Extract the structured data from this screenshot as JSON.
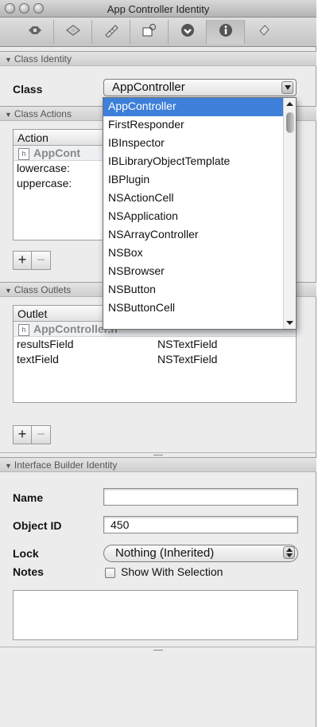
{
  "window": {
    "title": "App Controller Identity"
  },
  "toolbar": {
    "tabs": [
      {
        "icon": "attributes-icon"
      },
      {
        "icon": "effects-icon"
      },
      {
        "icon": "size-icon"
      },
      {
        "icon": "connections-icon"
      },
      {
        "icon": "bindings-icon"
      },
      {
        "icon": "identity-icon"
      },
      {
        "icon": "more-icon"
      }
    ]
  },
  "class_identity": {
    "header": "Class Identity",
    "class_label": "Class",
    "class_value": "AppController"
  },
  "dropdown": {
    "items": [
      "AppController",
      "FirstResponder",
      "IBInspector",
      "IBLibraryObjectTemplate",
      "IBPlugin",
      "NSActionCell",
      "NSApplication",
      "NSArrayController",
      "NSBox",
      "NSBrowser",
      "NSButton",
      "NSButtonCell"
    ],
    "selected_index": 0
  },
  "class_actions": {
    "header": "Class Actions",
    "column_header": "Action",
    "file_name": "AppCont",
    "actions": [
      "lowercase:",
      "uppercase:"
    ],
    "add_label": "+",
    "remove_label": "−"
  },
  "class_outlets": {
    "header": "Class Outlets",
    "column_header": "Outlet",
    "file_name": "AppController.h",
    "outlets": [
      {
        "name": "resultsField",
        "type": "NSTextField"
      },
      {
        "name": "textField",
        "type": "NSTextField"
      }
    ],
    "add_label": "+",
    "remove_label": "−"
  },
  "ib_identity": {
    "header": "Interface Builder Identity",
    "name_label": "Name",
    "name_value": "",
    "object_id_label": "Object ID",
    "object_id_value": "450",
    "lock_label": "Lock",
    "lock_value": "Nothing (Inherited)",
    "notes_label": "Notes",
    "show_with_selection_label": "Show With Selection",
    "notes_value": ""
  }
}
